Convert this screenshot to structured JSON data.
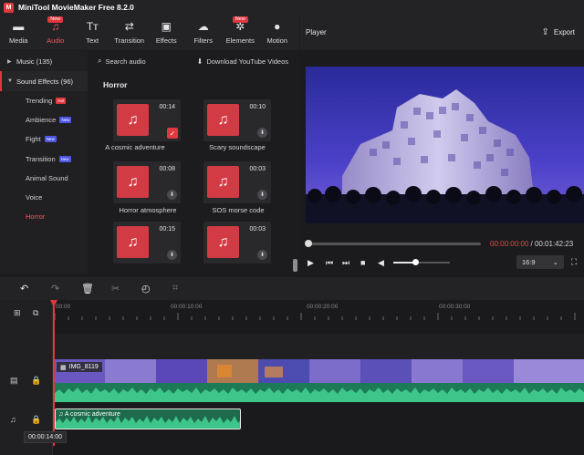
{
  "app": {
    "title": "MiniTool MovieMaker Free 8.2.0"
  },
  "toolbar": {
    "items": [
      {
        "label": "Media",
        "icon": "folder-icon"
      },
      {
        "label": "Audio",
        "icon": "music-note-icon",
        "badge": "New",
        "active": true
      },
      {
        "label": "Text",
        "icon": "text-icon"
      },
      {
        "label": "Transition",
        "icon": "swap-arrows-icon"
      },
      {
        "label": "Effects",
        "icon": "effects-icon"
      },
      {
        "label": "Filters",
        "icon": "cloud-filter-icon"
      },
      {
        "label": "Elements",
        "icon": "elements-icon",
        "badge": "New"
      },
      {
        "label": "Motion",
        "icon": "motion-icon"
      }
    ]
  },
  "player": {
    "title": "Player",
    "export_label": "Export",
    "current_time": "00:00:00:00",
    "separator": " / ",
    "total_time": "00:01:42:23",
    "aspect": "16:9"
  },
  "categories": {
    "music": {
      "label": "Music (135)"
    },
    "sound_effects": {
      "label": "Sound Effects (96)"
    },
    "subs": [
      {
        "label": "Trending",
        "tag": "Hot"
      },
      {
        "label": "Ambience",
        "tag": "New"
      },
      {
        "label": "Fight",
        "tag": "New"
      },
      {
        "label": "Transition",
        "tag": "New"
      },
      {
        "label": "Animal Sound",
        "tag": ""
      },
      {
        "label": "Voice",
        "tag": ""
      },
      {
        "label": "Horror",
        "tag": "",
        "active": true
      }
    ]
  },
  "library": {
    "search_label": "Search audio",
    "download_label": "Download YouTube Videos",
    "section": "Horror",
    "cards": [
      {
        "duration": "00:14",
        "title": "A cosmic adventure",
        "added": true
      },
      {
        "duration": "00:10",
        "title": "Scary soundscape",
        "added": false
      },
      {
        "duration": "00:08",
        "title": "Horror atmosphere",
        "added": false
      },
      {
        "duration": "00:03",
        "title": "SOS morse code",
        "added": false
      },
      {
        "duration": "00:15",
        "title": "",
        "added": false
      },
      {
        "duration": "00:03",
        "title": "",
        "added": false
      }
    ]
  },
  "timeline": {
    "ticks": [
      "00:00",
      "00:00:10:00",
      "00:00:20:00",
      "00:00:30:00"
    ],
    "video_clip_label": "IMG_8119",
    "audio_clip_label": "A cosmic adventure",
    "tooltip": "00:00:14:00"
  },
  "colors": {
    "accent": "#e0383e",
    "audio_track": "#1d6b4c",
    "waveform": "#3ec58a"
  }
}
